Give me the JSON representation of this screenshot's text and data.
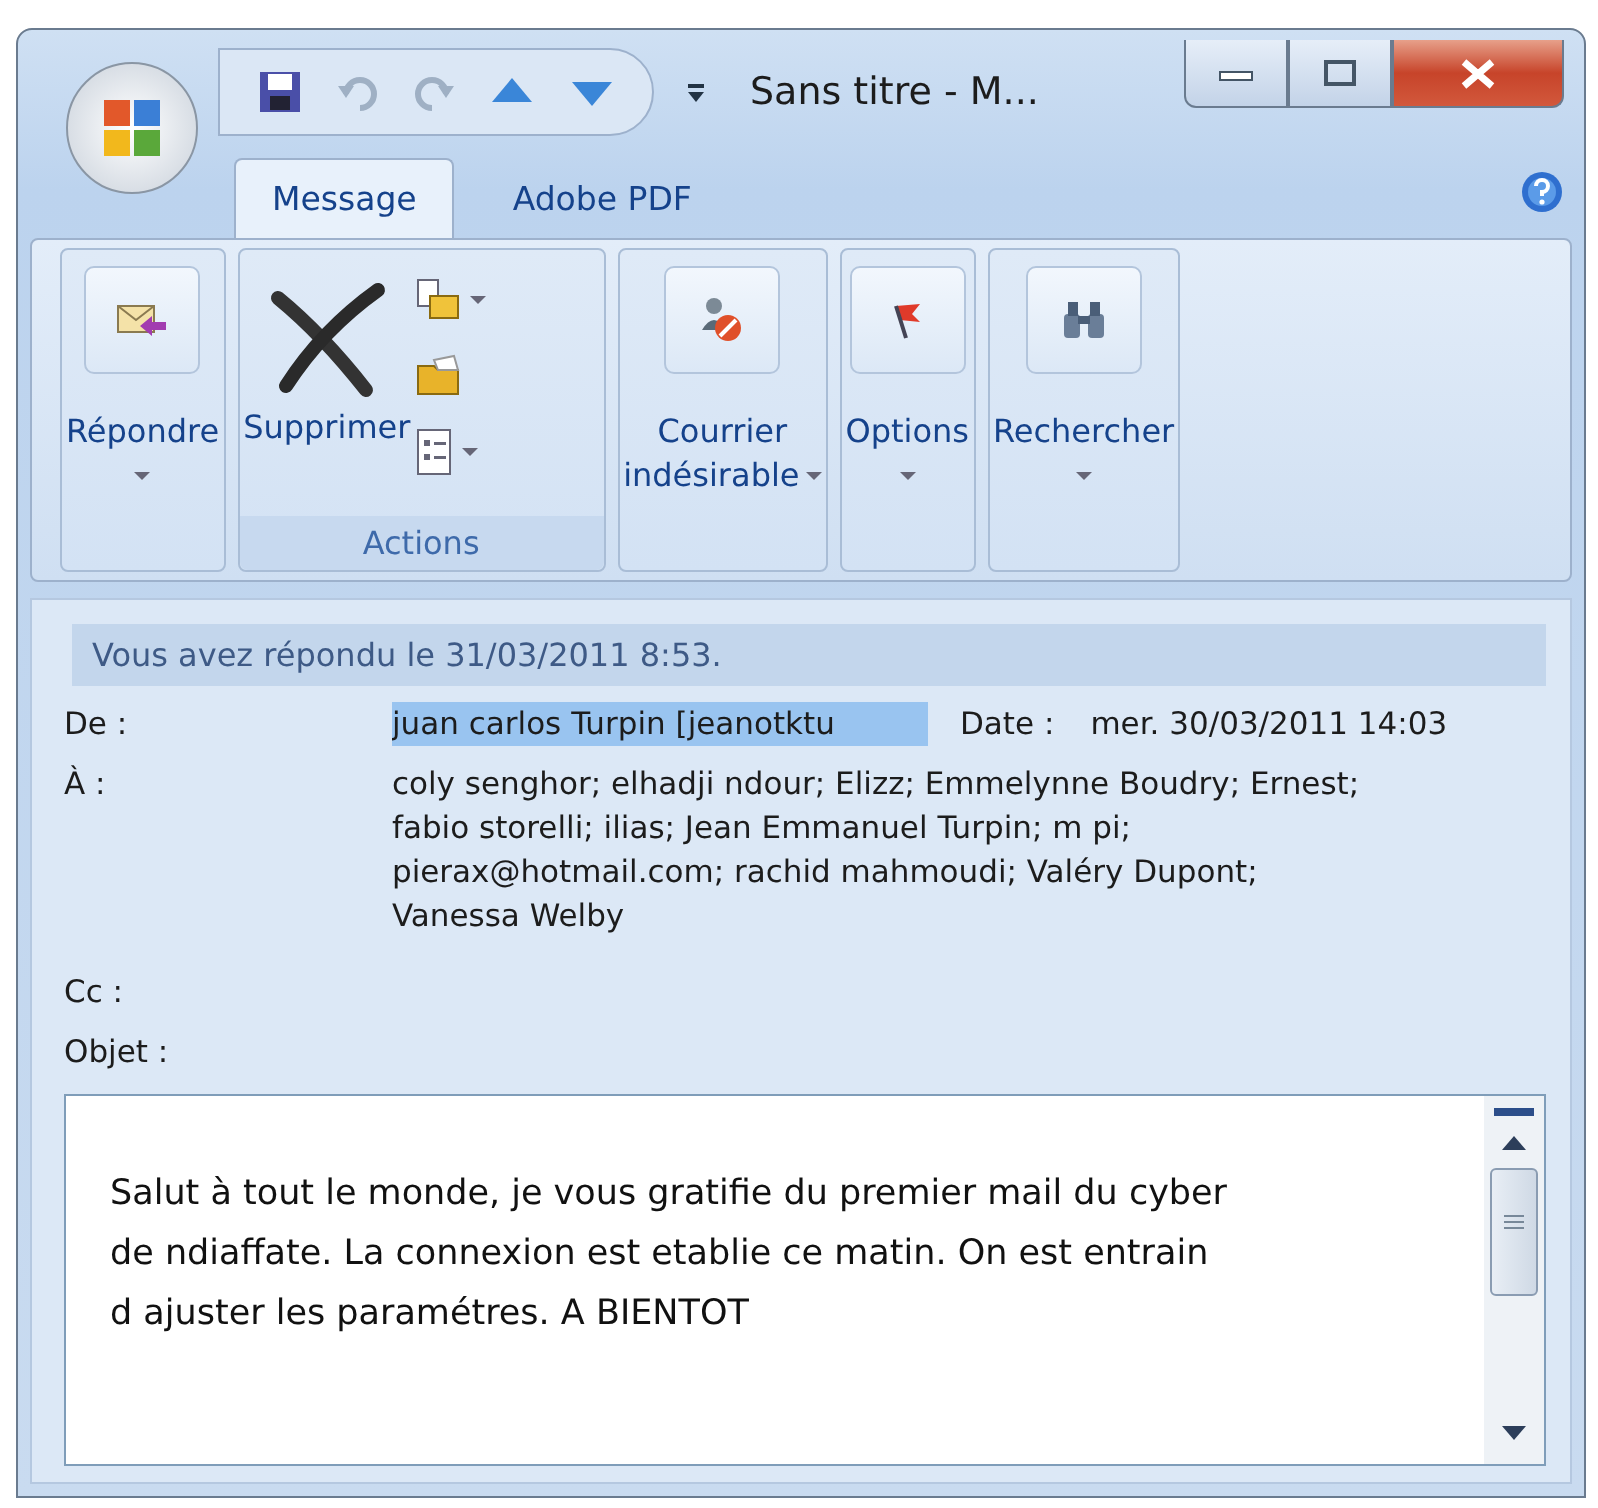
{
  "window": {
    "title": "Sans titre - M..."
  },
  "tabs": [
    {
      "label": "Message",
      "selected": true
    },
    {
      "label": "Adobe PDF",
      "selected": false
    }
  ],
  "ribbon": [
    {
      "kind": "large",
      "lines": [
        "Répondre"
      ],
      "dropdown": true
    },
    {
      "kind": "actions",
      "label": "Supprimer",
      "group_label": "Actions",
      "small": [
        {
          "dropdown": true
        },
        {
          "dropdown": false
        },
        {
          "dropdown": true
        }
      ]
    },
    {
      "kind": "large",
      "lines": [
        "Courrier",
        "indésirable"
      ],
      "dropdown": true
    },
    {
      "kind": "large",
      "lines": [
        "Options"
      ],
      "dropdown": true
    },
    {
      "kind": "large",
      "lines": [
        "Rechercher"
      ],
      "dropdown": true
    }
  ],
  "info_bar": "Vous avez répondu le 31/03/2011 8:53.",
  "from": {
    "label": "De :",
    "value": "juan carlos Turpin [jeanotktu",
    "selected": true
  },
  "date": {
    "label": "Date :",
    "value": "mer. 30/03/2011 14:03"
  },
  "to": {
    "label": "À :",
    "value": "coly senghor; elhadji ndour; Elizz; Emmelynne Boudry; Ernest; fabio storelli; ilias; Jean Emmanuel Turpin; m pi; pierax@hotmail.com; rachid mahmoudi; Valéry Dupont; Vanessa Welby"
  },
  "cc": {
    "label": "Cc :"
  },
  "subject": {
    "label": "Objet :"
  },
  "body": "Salut à tout le monde, je vous gratifie du premier mail du cyber de ndiaffate. La connexion est etablie ce matin. On est entrain d ajuster les paramétres. A BIENTOT"
}
